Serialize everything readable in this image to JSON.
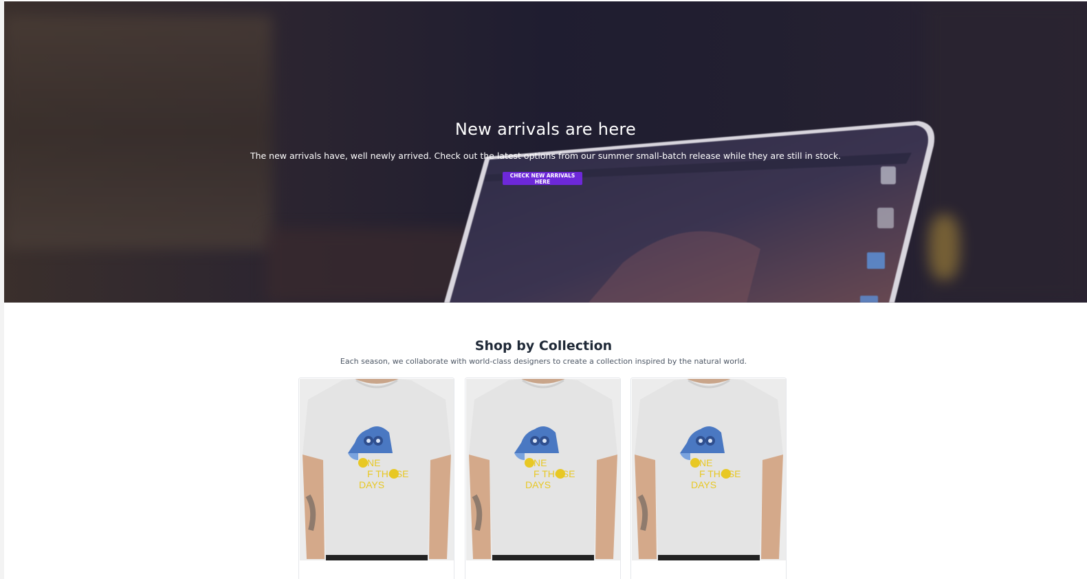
{
  "hero": {
    "title": "New arrivals are here",
    "description": "The new arrivals have, well newly arrived. Check out the latest options from our summer small-batch release while they are still in stock.",
    "button_label": "CHECK NEW ARRIVALS HERE"
  },
  "collection": {
    "title": "Shop by Collection",
    "description": "Each season, we collaborate with world-class designers to create a collection inspired by the natural world.",
    "items": [
      {
        "image": "t-shirt-product-image",
        "shirt_text": [
          "NE",
          "F THOSE",
          "DAYS"
        ]
      },
      {
        "image": "t-shirt-product-image",
        "shirt_text": [
          "NE",
          "F THOSE",
          "DAYS"
        ]
      },
      {
        "image": "t-shirt-product-image",
        "shirt_text": [
          "NE",
          "F THOSE",
          "DAYS"
        ]
      }
    ]
  },
  "colors": {
    "accent": "#6d28d9",
    "shirt_print_yellow": "#e8c824",
    "owl_blue": "#4a78c2"
  }
}
